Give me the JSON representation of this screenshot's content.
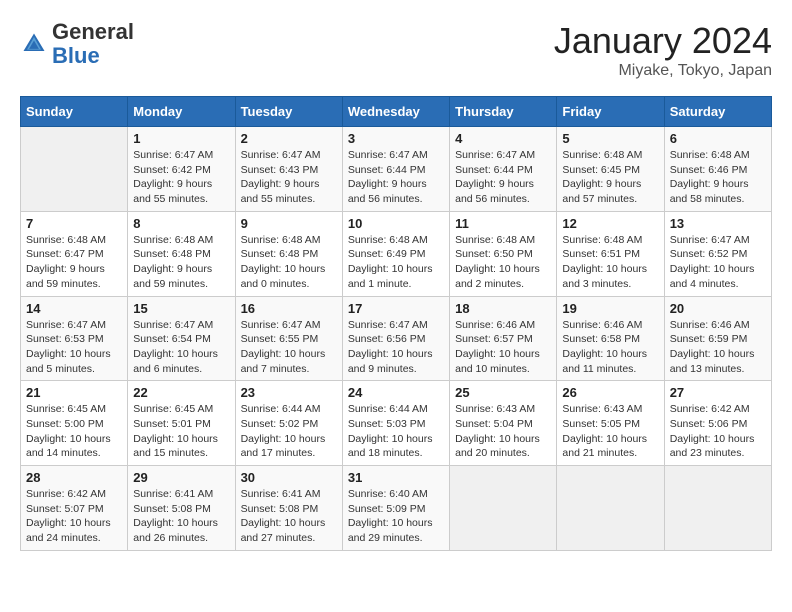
{
  "header": {
    "logo_general": "General",
    "logo_blue": "Blue",
    "title": "January 2024",
    "location": "Miyake, Tokyo, Japan"
  },
  "weekdays": [
    "Sunday",
    "Monday",
    "Tuesday",
    "Wednesday",
    "Thursday",
    "Friday",
    "Saturday"
  ],
  "weeks": [
    [
      {
        "day": "",
        "empty": true
      },
      {
        "day": "1",
        "sunrise": "Sunrise: 6:47 AM",
        "sunset": "Sunset: 6:42 PM",
        "daylight": "Daylight: 9 hours and 55 minutes."
      },
      {
        "day": "2",
        "sunrise": "Sunrise: 6:47 AM",
        "sunset": "Sunset: 6:43 PM",
        "daylight": "Daylight: 9 hours and 55 minutes."
      },
      {
        "day": "3",
        "sunrise": "Sunrise: 6:47 AM",
        "sunset": "Sunset: 6:44 PM",
        "daylight": "Daylight: 9 hours and 56 minutes."
      },
      {
        "day": "4",
        "sunrise": "Sunrise: 6:47 AM",
        "sunset": "Sunset: 6:44 PM",
        "daylight": "Daylight: 9 hours and 56 minutes."
      },
      {
        "day": "5",
        "sunrise": "Sunrise: 6:48 AM",
        "sunset": "Sunset: 6:45 PM",
        "daylight": "Daylight: 9 hours and 57 minutes."
      },
      {
        "day": "6",
        "sunrise": "Sunrise: 6:48 AM",
        "sunset": "Sunset: 6:46 PM",
        "daylight": "Daylight: 9 hours and 58 minutes."
      }
    ],
    [
      {
        "day": "7",
        "sunrise": "Sunrise: 6:48 AM",
        "sunset": "Sunset: 6:47 PM",
        "daylight": "Daylight: 9 hours and 59 minutes."
      },
      {
        "day": "8",
        "sunrise": "Sunrise: 6:48 AM",
        "sunset": "Sunset: 6:48 PM",
        "daylight": "Daylight: 9 hours and 59 minutes."
      },
      {
        "day": "9",
        "sunrise": "Sunrise: 6:48 AM",
        "sunset": "Sunset: 6:48 PM",
        "daylight": "Daylight: 10 hours and 0 minutes."
      },
      {
        "day": "10",
        "sunrise": "Sunrise: 6:48 AM",
        "sunset": "Sunset: 6:49 PM",
        "daylight": "Daylight: 10 hours and 1 minute."
      },
      {
        "day": "11",
        "sunrise": "Sunrise: 6:48 AM",
        "sunset": "Sunset: 6:50 PM",
        "daylight": "Daylight: 10 hours and 2 minutes."
      },
      {
        "day": "12",
        "sunrise": "Sunrise: 6:48 AM",
        "sunset": "Sunset: 6:51 PM",
        "daylight": "Daylight: 10 hours and 3 minutes."
      },
      {
        "day": "13",
        "sunrise": "Sunrise: 6:47 AM",
        "sunset": "Sunset: 6:52 PM",
        "daylight": "Daylight: 10 hours and 4 minutes."
      }
    ],
    [
      {
        "day": "14",
        "sunrise": "Sunrise: 6:47 AM",
        "sunset": "Sunset: 6:53 PM",
        "daylight": "Daylight: 10 hours and 5 minutes."
      },
      {
        "day": "15",
        "sunrise": "Sunrise: 6:47 AM",
        "sunset": "Sunset: 6:54 PM",
        "daylight": "Daylight: 10 hours and 6 minutes."
      },
      {
        "day": "16",
        "sunrise": "Sunrise: 6:47 AM",
        "sunset": "Sunset: 6:55 PM",
        "daylight": "Daylight: 10 hours and 7 minutes."
      },
      {
        "day": "17",
        "sunrise": "Sunrise: 6:47 AM",
        "sunset": "Sunset: 6:56 PM",
        "daylight": "Daylight: 10 hours and 9 minutes."
      },
      {
        "day": "18",
        "sunrise": "Sunrise: 6:46 AM",
        "sunset": "Sunset: 6:57 PM",
        "daylight": "Daylight: 10 hours and 10 minutes."
      },
      {
        "day": "19",
        "sunrise": "Sunrise: 6:46 AM",
        "sunset": "Sunset: 6:58 PM",
        "daylight": "Daylight: 10 hours and 11 minutes."
      },
      {
        "day": "20",
        "sunrise": "Sunrise: 6:46 AM",
        "sunset": "Sunset: 6:59 PM",
        "daylight": "Daylight: 10 hours and 13 minutes."
      }
    ],
    [
      {
        "day": "21",
        "sunrise": "Sunrise: 6:45 AM",
        "sunset": "Sunset: 5:00 PM",
        "daylight": "Daylight: 10 hours and 14 minutes."
      },
      {
        "day": "22",
        "sunrise": "Sunrise: 6:45 AM",
        "sunset": "Sunset: 5:01 PM",
        "daylight": "Daylight: 10 hours and 15 minutes."
      },
      {
        "day": "23",
        "sunrise": "Sunrise: 6:44 AM",
        "sunset": "Sunset: 5:02 PM",
        "daylight": "Daylight: 10 hours and 17 minutes."
      },
      {
        "day": "24",
        "sunrise": "Sunrise: 6:44 AM",
        "sunset": "Sunset: 5:03 PM",
        "daylight": "Daylight: 10 hours and 18 minutes."
      },
      {
        "day": "25",
        "sunrise": "Sunrise: 6:43 AM",
        "sunset": "Sunset: 5:04 PM",
        "daylight": "Daylight: 10 hours and 20 minutes."
      },
      {
        "day": "26",
        "sunrise": "Sunrise: 6:43 AM",
        "sunset": "Sunset: 5:05 PM",
        "daylight": "Daylight: 10 hours and 21 minutes."
      },
      {
        "day": "27",
        "sunrise": "Sunrise: 6:42 AM",
        "sunset": "Sunset: 5:06 PM",
        "daylight": "Daylight: 10 hours and 23 minutes."
      }
    ],
    [
      {
        "day": "28",
        "sunrise": "Sunrise: 6:42 AM",
        "sunset": "Sunset: 5:07 PM",
        "daylight": "Daylight: 10 hours and 24 minutes."
      },
      {
        "day": "29",
        "sunrise": "Sunrise: 6:41 AM",
        "sunset": "Sunset: 5:08 PM",
        "daylight": "Daylight: 10 hours and 26 minutes."
      },
      {
        "day": "30",
        "sunrise": "Sunrise: 6:41 AM",
        "sunset": "Sunset: 5:08 PM",
        "daylight": "Daylight: 10 hours and 27 minutes."
      },
      {
        "day": "31",
        "sunrise": "Sunrise: 6:40 AM",
        "sunset": "Sunset: 5:09 PM",
        "daylight": "Daylight: 10 hours and 29 minutes."
      },
      {
        "day": "",
        "empty": true
      },
      {
        "day": "",
        "empty": true
      },
      {
        "day": "",
        "empty": true
      }
    ]
  ]
}
